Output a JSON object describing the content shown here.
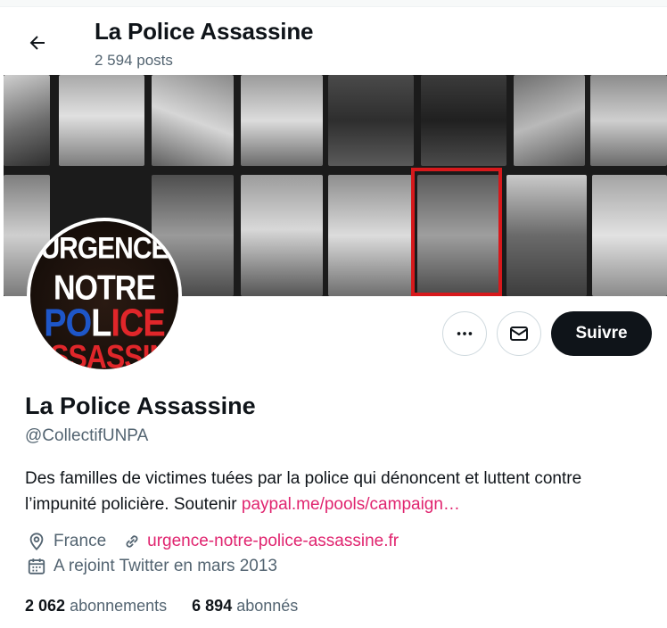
{
  "header": {
    "title": "La Police Assassine",
    "post_count": "2 594 posts"
  },
  "avatar": {
    "line1": "URGENCE",
    "line2": "NOTRE",
    "line3_a": "PO",
    "line3_b": "L",
    "line3_c": "ICE",
    "line4": "ASSASSINE"
  },
  "actions": {
    "follow_label": "Suivre"
  },
  "profile": {
    "name": "La Police Assassine",
    "handle": "@CollectifUNPA",
    "bio_text": "Des familles de victimes tuées par la police  qui dénoncent et luttent contre l’impunité policière. Soutenir ",
    "bio_link": "paypal.me/pools/campaign…",
    "location": "France",
    "website": "urgence-notre-police-assassine.fr",
    "joined": "A rejoint Twitter en mars 2013"
  },
  "stats": {
    "following_count": "2 062",
    "following_label": "abonnements",
    "followers_count": "6 894",
    "followers_label": "abonnés"
  },
  "colors": {
    "accent_link": "#e0246f",
    "follow_button": "#0f1419",
    "highlight_frame": "#d7191c"
  }
}
